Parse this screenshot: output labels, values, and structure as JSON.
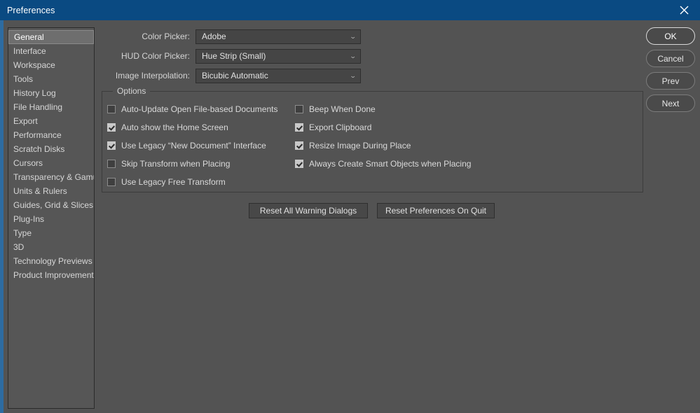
{
  "window": {
    "title": "Preferences",
    "close_icon": "close-icon",
    "titlebar_color": "#0a4a82",
    "background_color": "#535353"
  },
  "sidebar": {
    "items": [
      {
        "label": "General",
        "selected": true
      },
      {
        "label": "Interface",
        "selected": false
      },
      {
        "label": "Workspace",
        "selected": false
      },
      {
        "label": "Tools",
        "selected": false
      },
      {
        "label": "History Log",
        "selected": false
      },
      {
        "label": "File Handling",
        "selected": false
      },
      {
        "label": "Export",
        "selected": false
      },
      {
        "label": "Performance",
        "selected": false
      },
      {
        "label": "Scratch Disks",
        "selected": false
      },
      {
        "label": "Cursors",
        "selected": false
      },
      {
        "label": "Transparency & Gamut",
        "selected": false
      },
      {
        "label": "Units & Rulers",
        "selected": false
      },
      {
        "label": "Guides, Grid & Slices",
        "selected": false
      },
      {
        "label": "Plug-Ins",
        "selected": false
      },
      {
        "label": "Type",
        "selected": false
      },
      {
        "label": "3D",
        "selected": false
      },
      {
        "label": "Technology Previews",
        "selected": false
      },
      {
        "label": "Product Improvement",
        "selected": false
      }
    ]
  },
  "fields": [
    {
      "label": "Color Picker:",
      "value": "Adobe",
      "chevron": "chevron-down-icon"
    },
    {
      "label": "HUD Color Picker:",
      "value": "Hue Strip (Small)",
      "chevron": "chevron-down-icon"
    },
    {
      "label": "Image Interpolation:",
      "value": "Bicubic Automatic",
      "chevron": "chevron-down-icon"
    }
  ],
  "options": {
    "legend": "Options",
    "left_column": [
      {
        "label": "Auto-Update Open File-based Documents",
        "checked": false
      },
      {
        "label": "Auto show the Home Screen",
        "checked": true
      },
      {
        "label": "Use Legacy “New Document” Interface",
        "checked": true
      },
      {
        "label": "Skip Transform when Placing",
        "checked": false
      },
      {
        "label": "Use Legacy Free Transform",
        "checked": false
      }
    ],
    "right_column": [
      {
        "label": "Beep When Done",
        "checked": false
      },
      {
        "label": "Export Clipboard",
        "checked": true
      },
      {
        "label": "Resize Image During Place",
        "checked": true
      },
      {
        "label": "Always Create Smart Objects when Placing",
        "checked": true
      }
    ]
  },
  "reset_buttons": [
    {
      "label": "Reset All Warning Dialogs"
    },
    {
      "label": "Reset Preferences On Quit"
    }
  ],
  "side_buttons": [
    {
      "label": "OK",
      "primary": true
    },
    {
      "label": "Cancel",
      "primary": false
    },
    {
      "label": "Prev",
      "primary": false
    },
    {
      "label": "Next",
      "primary": false
    }
  ]
}
